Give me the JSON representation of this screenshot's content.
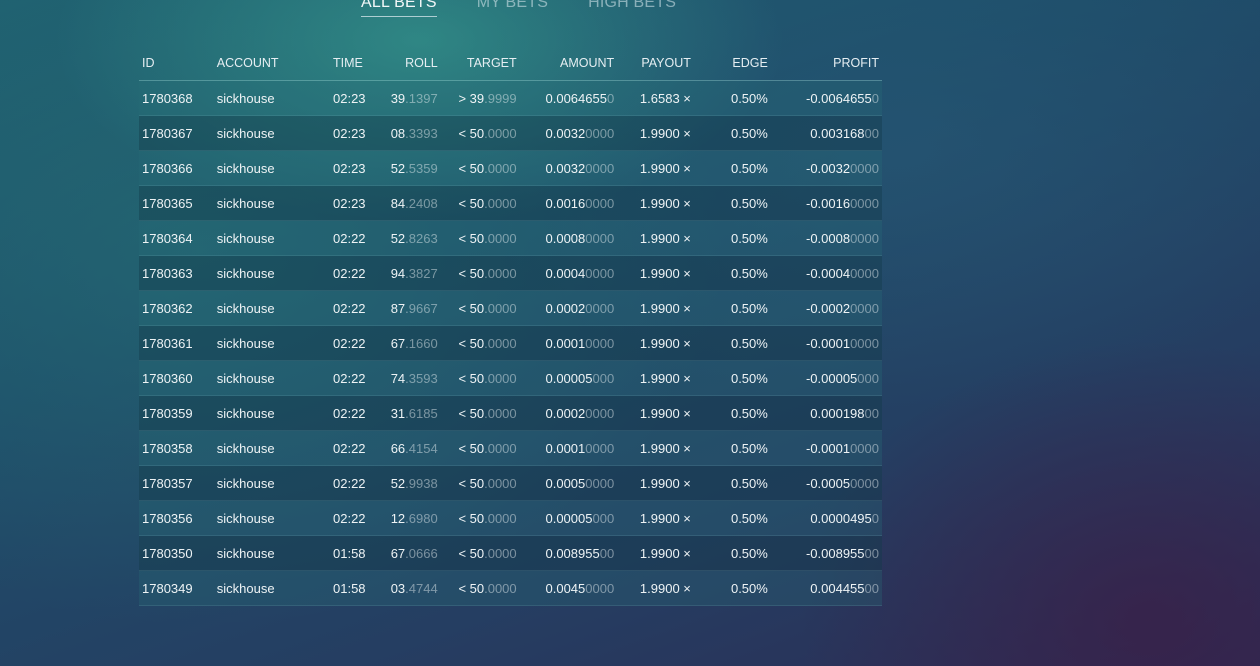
{
  "tabs": [
    {
      "label": "ALL BETS",
      "active": true
    },
    {
      "label": "MY BETS",
      "active": false
    },
    {
      "label": "HIGH BETS",
      "active": false
    }
  ],
  "table": {
    "columns": [
      "ID",
      "ACCOUNT",
      "TIME",
      "ROLL",
      "TARGET",
      "AMOUNT",
      "PAYOUT",
      "EDGE",
      "PROFIT"
    ],
    "rows": [
      {
        "id": "1780368",
        "account": "sickhouse",
        "time": "02:23",
        "roll_main": "39",
        "roll_dim": ".1397",
        "roll_win": false,
        "target_main": "> 39",
        "target_dim": ".9999",
        "amount_main": "0.0064655",
        "amount_dim": "0",
        "payout": "1.6583 ×",
        "edge": "0.50%",
        "profit_main": "-0.0064655",
        "profit_dim": "0",
        "profit_win": false
      },
      {
        "id": "1780367",
        "account": "sickhouse",
        "time": "02:23",
        "roll_main": "08",
        "roll_dim": ".3393",
        "roll_win": true,
        "target_main": "< 50",
        "target_dim": ".0000",
        "amount_main": "0.0032",
        "amount_dim": "0000",
        "payout": "1.9900 ×",
        "edge": "0.50%",
        "profit_main": "0.003168",
        "profit_dim": "00",
        "profit_win": true
      },
      {
        "id": "1780366",
        "account": "sickhouse",
        "time": "02:23",
        "roll_main": "52",
        "roll_dim": ".5359",
        "roll_win": false,
        "target_main": "< 50",
        "target_dim": ".0000",
        "amount_main": "0.0032",
        "amount_dim": "0000",
        "payout": "1.9900 ×",
        "edge": "0.50%",
        "profit_main": "-0.0032",
        "profit_dim": "0000",
        "profit_win": false
      },
      {
        "id": "1780365",
        "account": "sickhouse",
        "time": "02:23",
        "roll_main": "84",
        "roll_dim": ".2408",
        "roll_win": false,
        "target_main": "< 50",
        "target_dim": ".0000",
        "amount_main": "0.0016",
        "amount_dim": "0000",
        "payout": "1.9900 ×",
        "edge": "0.50%",
        "profit_main": "-0.0016",
        "profit_dim": "0000",
        "profit_win": false
      },
      {
        "id": "1780364",
        "account": "sickhouse",
        "time": "02:22",
        "roll_main": "52",
        "roll_dim": ".8263",
        "roll_win": false,
        "target_main": "< 50",
        "target_dim": ".0000",
        "amount_main": "0.0008",
        "amount_dim": "0000",
        "payout": "1.9900 ×",
        "edge": "0.50%",
        "profit_main": "-0.0008",
        "profit_dim": "0000",
        "profit_win": false
      },
      {
        "id": "1780363",
        "account": "sickhouse",
        "time": "02:22",
        "roll_main": "94",
        "roll_dim": ".3827",
        "roll_win": false,
        "target_main": "< 50",
        "target_dim": ".0000",
        "amount_main": "0.0004",
        "amount_dim": "0000",
        "payout": "1.9900 ×",
        "edge": "0.50%",
        "profit_main": "-0.0004",
        "profit_dim": "0000",
        "profit_win": false
      },
      {
        "id": "1780362",
        "account": "sickhouse",
        "time": "02:22",
        "roll_main": "87",
        "roll_dim": ".9667",
        "roll_win": false,
        "target_main": "< 50",
        "target_dim": ".0000",
        "amount_main": "0.0002",
        "amount_dim": "0000",
        "payout": "1.9900 ×",
        "edge": "0.50%",
        "profit_main": "-0.0002",
        "profit_dim": "0000",
        "profit_win": false
      },
      {
        "id": "1780361",
        "account": "sickhouse",
        "time": "02:22",
        "roll_main": "67",
        "roll_dim": ".1660",
        "roll_win": false,
        "target_main": "< 50",
        "target_dim": ".0000",
        "amount_main": "0.0001",
        "amount_dim": "0000",
        "payout": "1.9900 ×",
        "edge": "0.50%",
        "profit_main": "-0.0001",
        "profit_dim": "0000",
        "profit_win": false
      },
      {
        "id": "1780360",
        "account": "sickhouse",
        "time": "02:22",
        "roll_main": "74",
        "roll_dim": ".3593",
        "roll_win": false,
        "target_main": "< 50",
        "target_dim": ".0000",
        "amount_main": "0.00005",
        "amount_dim": "000",
        "payout": "1.9900 ×",
        "edge": "0.50%",
        "profit_main": "-0.00005",
        "profit_dim": "000",
        "profit_win": false
      },
      {
        "id": "1780359",
        "account": "sickhouse",
        "time": "02:22",
        "roll_main": "31",
        "roll_dim": ".6185",
        "roll_win": true,
        "target_main": "< 50",
        "target_dim": ".0000",
        "amount_main": "0.0002",
        "amount_dim": "0000",
        "payout": "1.9900 ×",
        "edge": "0.50%",
        "profit_main": "0.000198",
        "profit_dim": "00",
        "profit_win": true
      },
      {
        "id": "1780358",
        "account": "sickhouse",
        "time": "02:22",
        "roll_main": "66",
        "roll_dim": ".4154",
        "roll_win": false,
        "target_main": "< 50",
        "target_dim": ".0000",
        "amount_main": "0.0001",
        "amount_dim": "0000",
        "payout": "1.9900 ×",
        "edge": "0.50%",
        "profit_main": "-0.0001",
        "profit_dim": "0000",
        "profit_win": false
      },
      {
        "id": "1780357",
        "account": "sickhouse",
        "time": "02:22",
        "roll_main": "52",
        "roll_dim": ".9938",
        "roll_win": false,
        "target_main": "< 50",
        "target_dim": ".0000",
        "amount_main": "0.0005",
        "amount_dim": "0000",
        "payout": "1.9900 ×",
        "edge": "0.50%",
        "profit_main": "-0.0005",
        "profit_dim": "0000",
        "profit_win": false
      },
      {
        "id": "1780356",
        "account": "sickhouse",
        "time": "02:22",
        "roll_main": "12",
        "roll_dim": ".6980",
        "roll_win": true,
        "target_main": "< 50",
        "target_dim": ".0000",
        "amount_main": "0.00005",
        "amount_dim": "000",
        "payout": "1.9900 ×",
        "edge": "0.50%",
        "profit_main": "0.0000495",
        "profit_dim": "0",
        "profit_win": true
      },
      {
        "id": "1780350",
        "account": "sickhouse",
        "time": "01:58",
        "roll_main": "67",
        "roll_dim": ".0666",
        "roll_win": false,
        "target_main": "< 50",
        "target_dim": ".0000",
        "amount_main": "0.008955",
        "amount_dim": "00",
        "payout": "1.9900 ×",
        "edge": "0.50%",
        "profit_main": "-0.008955",
        "profit_dim": "00",
        "profit_win": false
      },
      {
        "id": "1780349",
        "account": "sickhouse",
        "time": "01:58",
        "roll_main": "03",
        "roll_dim": ".4744",
        "roll_win": true,
        "target_main": "< 50",
        "target_dim": ".0000",
        "amount_main": "0.0045",
        "amount_dim": "0000",
        "payout": "1.9900 ×",
        "edge": "0.50%",
        "profit_main": "0.004455",
        "profit_dim": "00",
        "profit_win": true
      }
    ]
  },
  "colors": {
    "win": "#3fe85e",
    "loss": "#f0777a",
    "text": "#eef3f5"
  }
}
